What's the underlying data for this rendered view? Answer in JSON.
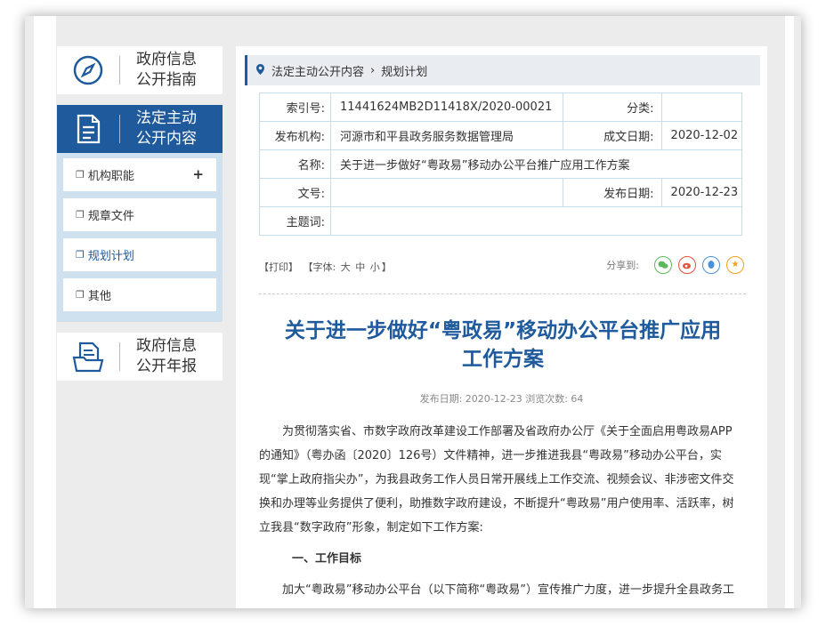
{
  "sidebar": {
    "guide": {
      "line1": "政府信息",
      "line2": "公开指南"
    },
    "statutory": {
      "line1": "法定主动",
      "line2": "公开内容"
    },
    "subitems": [
      {
        "label": "机构职能",
        "plus": "+"
      },
      {
        "label": "规章文件"
      },
      {
        "label": "规划计划"
      },
      {
        "label": "其他"
      }
    ],
    "annual": {
      "line1": "政府信息",
      "line2": "公开年报"
    }
  },
  "breadcrumb": {
    "root": "法定主动公开内容",
    "current": "规划计划"
  },
  "meta": {
    "index_label": "索引号:",
    "index_value": "11441624MB2D11418X/2020-00021",
    "category_label": "分类:",
    "category_value": "",
    "publisher_label": "发布机构:",
    "publisher_value": "河源市和平县政务服务数据管理局",
    "created_label": "成文日期:",
    "created_value": "2020-12-02",
    "name_label": "名称:",
    "name_value": "关于进一步做好“粤政易”移动办公平台推广应用工作方案",
    "docno_label": "文号:",
    "docno_value": "",
    "published_label": "发布日期:",
    "published_value": "2020-12-23",
    "topic_label": "主题词:",
    "topic_value": ""
  },
  "tools": {
    "print": "【打印】",
    "font": "【字体:",
    "large": "大",
    "medium": "中",
    "small": "小",
    "close": "】"
  },
  "share": {
    "label": "分享到:",
    "icons": [
      "wechat-icon",
      "weibo-icon",
      "qq-icon",
      "favorite-icon"
    ]
  },
  "article": {
    "title_line1": "关于进一步做好“粤政易”移动办公平台推广应用",
    "title_line2": "工作方案",
    "pubinfo": "发布日期: 2020-12-23  浏览次数: 64",
    "para1": "为贯彻落实省、市数字政府改革建设工作部署及省政府办公厅《关于全面启用粤政易APP的通知》（粤办函〔2020〕126号）文件精神，进一步推进我县“粤政易”移动办公平台，实现“掌上政府指尖办”，为我县政务工作人员日常开展线上工作交流、视频会议、非涉密文件交换和办理等业务提供了便利，助推数字政府建设，不断提升“粤政易”用户使用率、活跃率，树立我县“数字政府”形象，制定如下工作方案:",
    "heading1": "一、工作目标",
    "para2": "加大“粤政易”移动办公平台（以下简称“粤政易”）宣传推广力度，进一步提升全县政务工"
  },
  "colors": {
    "accent": "#1e5a9c",
    "sidebar_bg": "#cfe0ee",
    "title": "#1e5a9c"
  }
}
